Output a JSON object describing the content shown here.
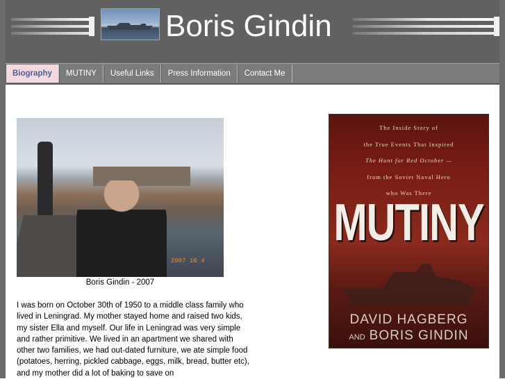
{
  "site": {
    "title": "Boris Gindin"
  },
  "nav": {
    "items": [
      {
        "label": "Biography",
        "active": true
      },
      {
        "label": "MUTINY",
        "active": false
      },
      {
        "label": "Useful Links",
        "active": false
      },
      {
        "label": "Press Information",
        "active": false
      },
      {
        "label": "Contact Me",
        "active": false
      }
    ]
  },
  "main": {
    "photo_date_stamp": "2007 10 4",
    "photo_caption": "Boris Gindin - 2007",
    "bio_text": "  I was born on October 30th of 1950 to a middle class family who lived in Leningrad. My mother stayed home and raised two kids, my sister Ella and myself. Our life in Leningrad was very simple and rather primitive. We lived in an apartment we shared with other two families, we had out-dated furniture, we ate simple food (potatoes, herring, pickled cabbage, eggs, milk, bread, butter etc), and my mother did a lot of baking to save on"
  },
  "book": {
    "tagline_1": "The Inside Story of",
    "tagline_2": "the True Events That Inspired",
    "tagline_3": "The Hunt for Red October —",
    "tagline_4": "from the Soviet Naval Hero",
    "tagline_5": "who Was There",
    "title": "MUTINY",
    "author_1": "DAVID HAGBERG",
    "author_and": "AND",
    "author_2": "BORIS GINDIN"
  },
  "colors": {
    "header_bg": "#616161",
    "nav_bg": "#7b7b7b",
    "nav_active_bg": "#f2d9dd",
    "nav_active_text": "#4a5fa0"
  }
}
